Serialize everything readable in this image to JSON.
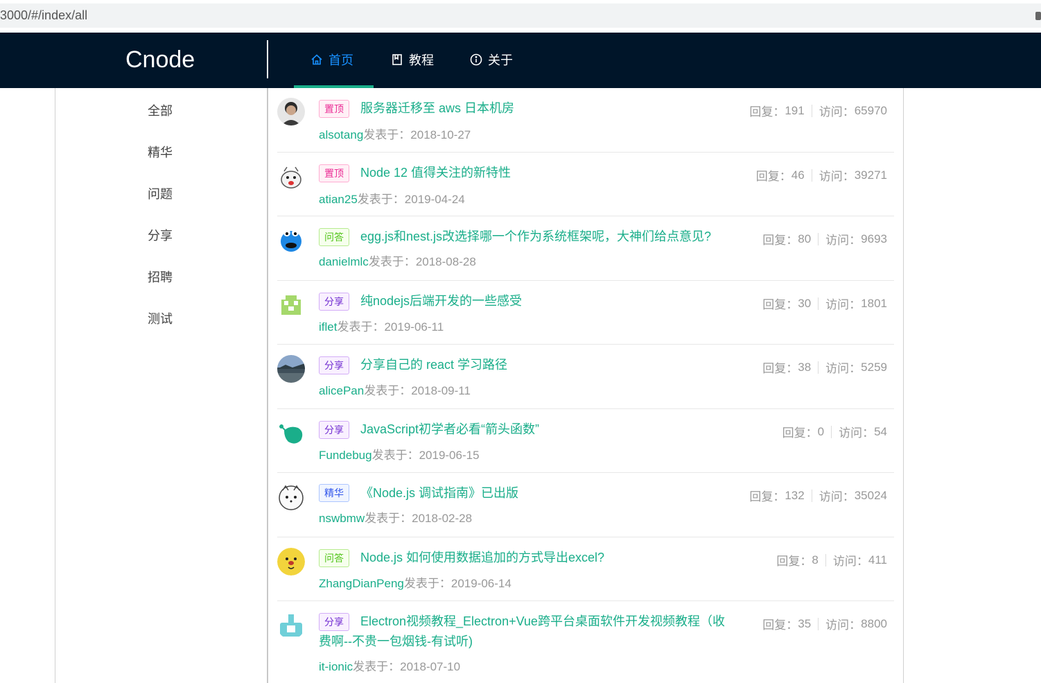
{
  "browser": {
    "url": "3000/#/index/all"
  },
  "header": {
    "logo": "Cnode",
    "nav": [
      {
        "label": "首页",
        "icon": "home-icon",
        "active": true
      },
      {
        "label": "教程",
        "icon": "book-icon",
        "active": false
      },
      {
        "label": "关于",
        "icon": "info-icon",
        "active": false
      }
    ]
  },
  "sidebar": {
    "items": [
      {
        "label": "全部"
      },
      {
        "label": "精华"
      },
      {
        "label": "问题"
      },
      {
        "label": "分享"
      },
      {
        "label": "招聘"
      },
      {
        "label": "测试"
      }
    ]
  },
  "topics": [
    {
      "tag": "置顶",
      "tag_type": "top",
      "title": "服务器迁移至 aws 日本机房",
      "author": "alsotang",
      "posted_label": "发表于：",
      "date": "2018-10-27",
      "replies_label": "回复：",
      "replies": "191",
      "visits_label": "访问：",
      "visits": "65970"
    },
    {
      "tag": "置顶",
      "tag_type": "top",
      "title": "Node 12 值得关注的新特性",
      "author": "atian25",
      "posted_label": "发表于：",
      "date": "2019-04-24",
      "replies_label": "回复：",
      "replies": "46",
      "visits_label": "访问：",
      "visits": "39271"
    },
    {
      "tag": "问答",
      "tag_type": "ask",
      "title": "egg.js和nest.js改选择哪一个作为系统框架呢，大神们给点意见?",
      "author": "danielmlc",
      "posted_label": "发表于：",
      "date": "2018-08-28",
      "replies_label": "回复：",
      "replies": "80",
      "visits_label": "访问：",
      "visits": "9693"
    },
    {
      "tag": "分享",
      "tag_type": "share",
      "title": "纯nodejs后端开发的一些感受",
      "author": "iflet",
      "posted_label": "发表于：",
      "date": "2019-06-11",
      "replies_label": "回复：",
      "replies": "30",
      "visits_label": "访问：",
      "visits": "1801"
    },
    {
      "tag": "分享",
      "tag_type": "share",
      "title": "分享自己的 react 学习路径",
      "author": "alicePan",
      "posted_label": "发表于：",
      "date": "2018-09-11",
      "replies_label": "回复：",
      "replies": "38",
      "visits_label": "访问：",
      "visits": "5259"
    },
    {
      "tag": "分享",
      "tag_type": "share",
      "title": "JavaScript初学者必看“箭头函数”",
      "author": "Fundebug",
      "posted_label": "发表于：",
      "date": "2019-06-15",
      "replies_label": "回复：",
      "replies": "0",
      "visits_label": "访问：",
      "visits": "54"
    },
    {
      "tag": "精华",
      "tag_type": "good",
      "title": "《Node.js 调试指南》已出版",
      "author": "nswbmw",
      "posted_label": "发表于：",
      "date": "2018-02-28",
      "replies_label": "回复：",
      "replies": "132",
      "visits_label": "访问：",
      "visits": "35024"
    },
    {
      "tag": "问答",
      "tag_type": "ask",
      "title": "Node.js 如何使用数据追加的方式导出excel?",
      "author": "ZhangDianPeng",
      "posted_label": "发表于：",
      "date": "2019-06-14",
      "replies_label": "回复：",
      "replies": "8",
      "visits_label": "访问：",
      "visits": "411"
    },
    {
      "tag": "分享",
      "tag_type": "share",
      "title_line1": "Electron视频教程_Electron+Vue跨平台桌面软件开发视频教程（收",
      "title_line2": "费啊--不贵一包烟钱-有试听)",
      "author": "it-ionic",
      "posted_label": "发表于：",
      "date": "2018-07-10",
      "replies_label": "回复：",
      "replies": "35",
      "visits_label": "访问：",
      "visits": "8800"
    }
  ],
  "colors": {
    "header_bg": "#001529",
    "accent": "#1aae8a",
    "active_nav": "#1890ff"
  }
}
